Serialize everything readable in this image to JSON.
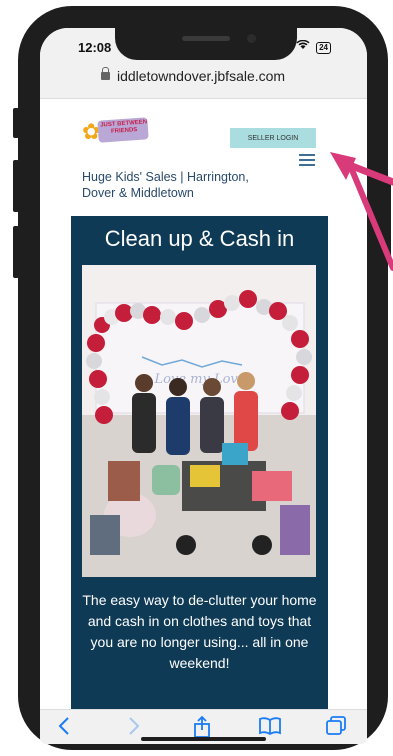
{
  "status": {
    "time": "12:08",
    "battery": "24"
  },
  "browser": {
    "url": "iddletowndover.jbfsale.com"
  },
  "header": {
    "logo_text": "JUST BETWEEN FRIENDS",
    "seller_login": "SELLER LOGIN",
    "site_title": "Huge Kids' Sales | Harrington, Dover & Middletown"
  },
  "hero": {
    "headline": "Clean up & Cash in",
    "photo_banner": "Love my Love",
    "tagline": "The easy way to de-clutter your home and cash in on clothes and toys that you are no longer using... all in one weekend!"
  },
  "toolbar": {
    "back": "<",
    "forward": ">",
    "share": "share",
    "bookmarks": "bookmarks",
    "tabs": "tabs"
  },
  "colors": {
    "panel": "#0f3a55",
    "seller_button": "#a9dde0",
    "annotation_arrow": "#d93a7a",
    "ios_blue": "#1b7cf5"
  }
}
